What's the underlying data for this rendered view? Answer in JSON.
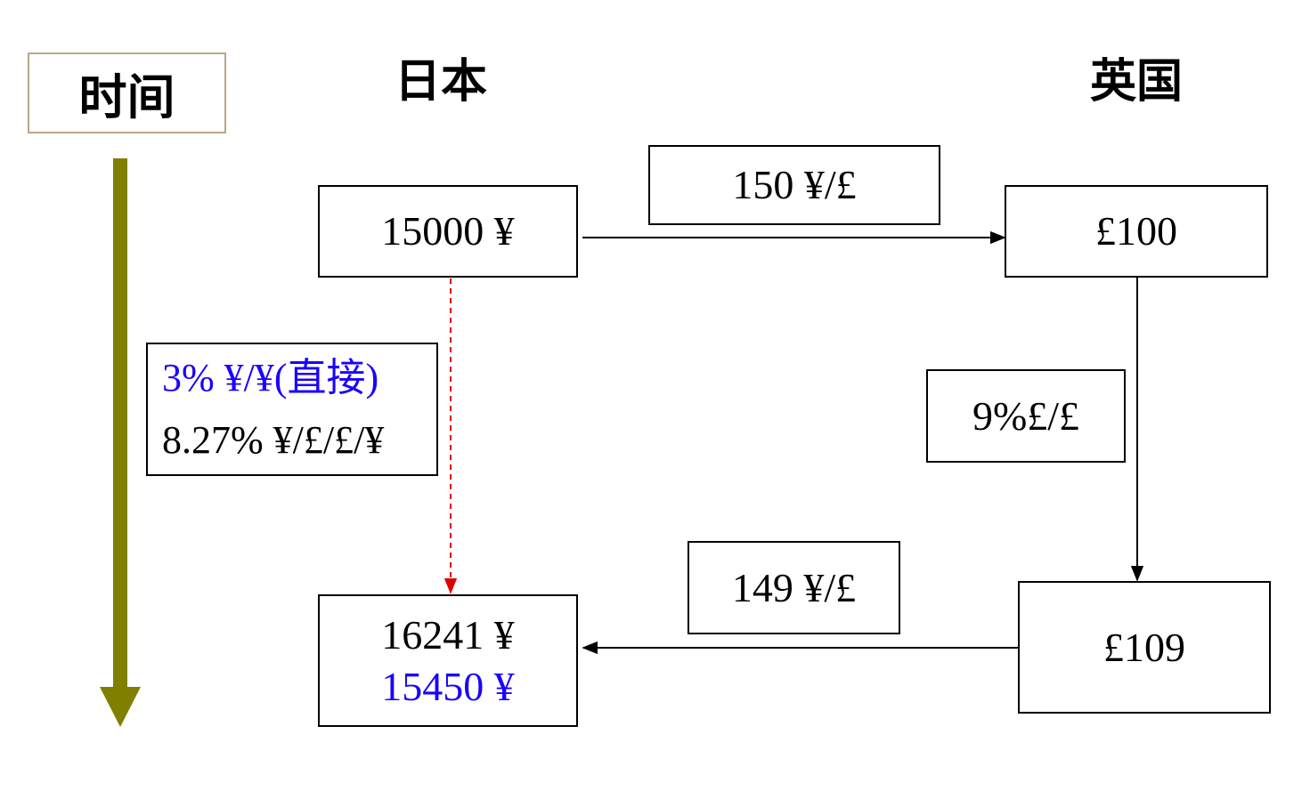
{
  "time_label": "时间",
  "headers": {
    "japan": "日本",
    "uk": "英国"
  },
  "boxes": {
    "jp_start": "15000 ¥",
    "uk_start": "£100",
    "rate_spot": "150 ¥/£",
    "uk_rate": "9%£/£",
    "uk_end": "£109",
    "rate_forward": "149 ¥/£",
    "jp_end_converted": "16241 ¥",
    "jp_end_direct": "15450 ¥",
    "jp_rate_direct": "3% ¥/¥(直接)",
    "jp_rate_indirect": "8.27% ¥/£/£/¥"
  },
  "colors": {
    "time_arrow": "#7f7f00",
    "dashed_arrow": "#e00000",
    "highlight_text": "#1a00ff",
    "label_border": "#b8a888"
  }
}
